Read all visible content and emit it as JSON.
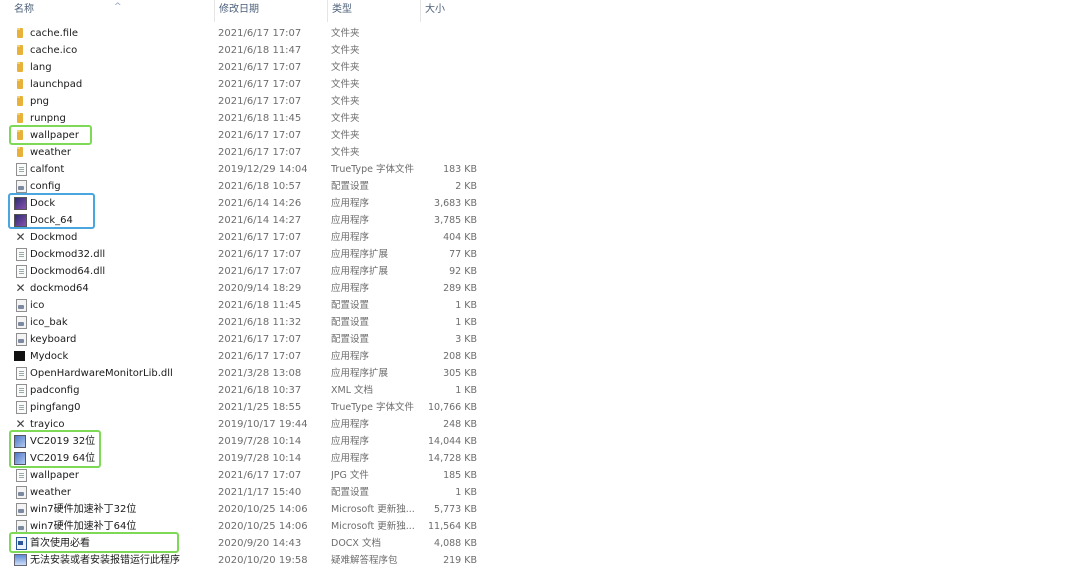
{
  "columns": {
    "name": "名称",
    "date": "修改日期",
    "type": "类型",
    "size": "大小"
  },
  "files": [
    {
      "name": "cache.file",
      "date": "2021/6/17 17:07",
      "type": "文件夹",
      "size": "",
      "icon": "folder-icon"
    },
    {
      "name": "cache.ico",
      "date": "2021/6/18 11:47",
      "type": "文件夹",
      "size": "",
      "icon": "folder-icon"
    },
    {
      "name": "lang",
      "date": "2021/6/17 17:07",
      "type": "文件夹",
      "size": "",
      "icon": "folder-icon"
    },
    {
      "name": "launchpad",
      "date": "2021/6/17 17:07",
      "type": "文件夹",
      "size": "",
      "icon": "folder-icon"
    },
    {
      "name": "png",
      "date": "2021/6/17 17:07",
      "type": "文件夹",
      "size": "",
      "icon": "folder-icon"
    },
    {
      "name": "runpng",
      "date": "2021/6/18 11:45",
      "type": "文件夹",
      "size": "",
      "icon": "folder-icon"
    },
    {
      "name": "wallpaper",
      "date": "2021/6/17 17:07",
      "type": "文件夹",
      "size": "",
      "icon": "folder-icon"
    },
    {
      "name": "weather",
      "date": "2021/6/17 17:07",
      "type": "文件夹",
      "size": "",
      "icon": "folder-icon"
    },
    {
      "name": "calfont",
      "date": "2019/12/29 14:04",
      "type": "TrueType 字体文件",
      "size": "183 KB",
      "icon": "font-file-icon"
    },
    {
      "name": "config",
      "date": "2021/6/18 10:57",
      "type": "配置设置",
      "size": "2 KB",
      "icon": "config-file-icon"
    },
    {
      "name": "Dock",
      "date": "2021/6/14 14:26",
      "type": "应用程序",
      "size": "3,683 KB",
      "icon": "dock-app-icon"
    },
    {
      "name": "Dock_64",
      "date": "2021/6/14 14:27",
      "type": "应用程序",
      "size": "3,785 KB",
      "icon": "dock-app-icon"
    },
    {
      "name": "Dockmod",
      "date": "2021/6/17 17:07",
      "type": "应用程序",
      "size": "404 KB",
      "icon": "tools-app-icon"
    },
    {
      "name": "Dockmod32.dll",
      "date": "2021/6/17 17:07",
      "type": "应用程序扩展",
      "size": "77 KB",
      "icon": "dll-file-icon"
    },
    {
      "name": "Dockmod64.dll",
      "date": "2021/6/17 17:07",
      "type": "应用程序扩展",
      "size": "92 KB",
      "icon": "dll-file-icon"
    },
    {
      "name": "dockmod64",
      "date": "2020/9/14 18:29",
      "type": "应用程序",
      "size": "289 KB",
      "icon": "tools-app-icon"
    },
    {
      "name": "ico",
      "date": "2021/6/18 11:45",
      "type": "配置设置",
      "size": "1 KB",
      "icon": "config-file-icon"
    },
    {
      "name": "ico_bak",
      "date": "2021/6/18 11:32",
      "type": "配置设置",
      "size": "1 KB",
      "icon": "config-file-icon"
    },
    {
      "name": "keyboard",
      "date": "2021/6/17 17:07",
      "type": "配置设置",
      "size": "3 KB",
      "icon": "config-file-icon"
    },
    {
      "name": "Mydock",
      "date": "2021/6/17 17:07",
      "type": "应用程序",
      "size": "208 KB",
      "icon": "black-app-icon"
    },
    {
      "name": "OpenHardwareMonitorLib.dll",
      "date": "2021/3/28 13:08",
      "type": "应用程序扩展",
      "size": "305 KB",
      "icon": "dll-file-icon"
    },
    {
      "name": "padconfig",
      "date": "2021/6/18 10:37",
      "type": "XML 文档",
      "size": "1 KB",
      "icon": "xml-file-icon"
    },
    {
      "name": "pingfang0",
      "date": "2021/1/25 18:55",
      "type": "TrueType 字体文件",
      "size": "10,766 KB",
      "icon": "font-file-icon"
    },
    {
      "name": "trayico",
      "date": "2019/10/17 19:44",
      "type": "应用程序",
      "size": "248 KB",
      "icon": "tools-app-icon"
    },
    {
      "name": "VC2019 32位",
      "date": "2019/7/28 10:14",
      "type": "应用程序",
      "size": "14,044 KB",
      "icon": "installer-icon"
    },
    {
      "name": "VC2019 64位",
      "date": "2019/7/28 10:14",
      "type": "应用程序",
      "size": "14,728 KB",
      "icon": "installer-icon"
    },
    {
      "name": "wallpaper",
      "date": "2021/6/17 17:07",
      "type": "JPG 文件",
      "size": "185 KB",
      "icon": "image-file-icon"
    },
    {
      "name": "weather",
      "date": "2021/1/17 15:40",
      "type": "配置设置",
      "size": "1 KB",
      "icon": "config-file-icon"
    },
    {
      "name": "win7硬件加速补丁32位",
      "date": "2020/10/25 14:06",
      "type": "Microsoft 更新独...",
      "size": "5,773 KB",
      "icon": "update-package-icon"
    },
    {
      "name": "win7硬件加速补丁64位",
      "date": "2020/10/25 14:06",
      "type": "Microsoft 更新独...",
      "size": "11,564 KB",
      "icon": "update-package-icon"
    },
    {
      "name": "首次使用必看",
      "date": "2020/9/20 14:43",
      "type": "DOCX 文档",
      "size": "4,088 KB",
      "icon": "word-doc-icon"
    },
    {
      "name": "无法安装或者安装报错运行此程序",
      "date": "2020/10/20 19:58",
      "type": "疑难解答程序包",
      "size": "219 KB",
      "icon": "troubleshooter-icon"
    }
  ],
  "highlight_colors": {
    "green": "#7ed957",
    "blue": "#4aa6de"
  }
}
